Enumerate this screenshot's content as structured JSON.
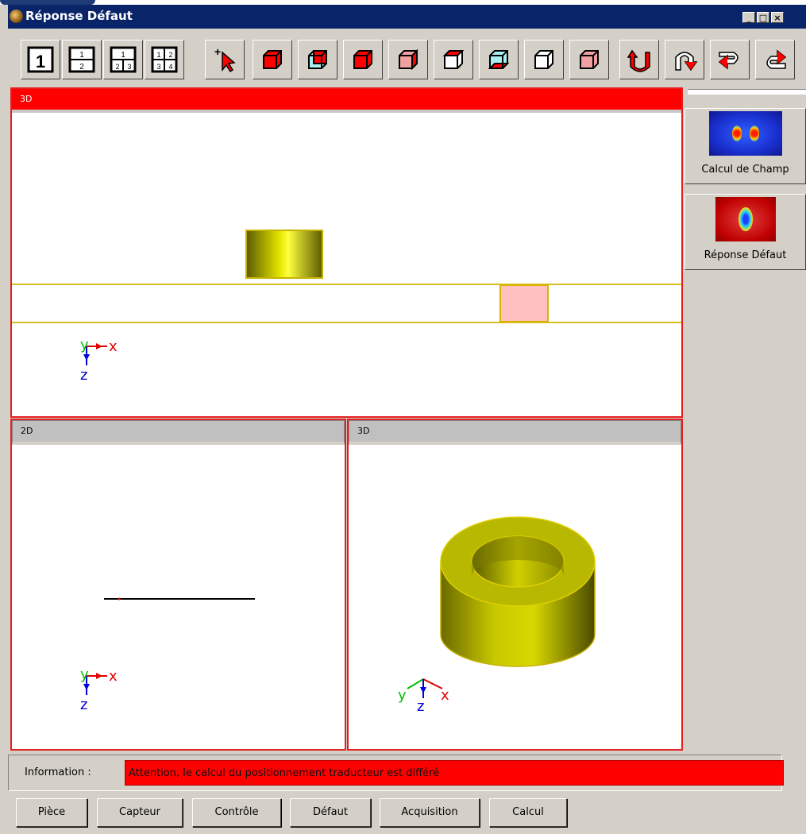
{
  "window": {
    "title": "Réponse Défaut",
    "min_label": "_",
    "max_label": "□",
    "close_label": "×"
  },
  "toolbar": {
    "layout_buttons": [
      {
        "name": "layout-1-button",
        "icon": "layout-single-icon"
      },
      {
        "name": "layout-2-button",
        "icon": "layout-split-2-icon"
      },
      {
        "name": "layout-3-button",
        "icon": "layout-split-3-icon"
      },
      {
        "name": "layout-4-button",
        "icon": "layout-split-4-icon"
      }
    ],
    "tools": [
      "select-add-icon",
      "cube-front-icon",
      "cube-back-icon",
      "cube-left-icon",
      "cube-right-icon",
      "cube-top-icon",
      "cube-bottom-icon",
      "cube-iso-1-icon",
      "cube-iso-2-icon",
      "rotate-up-icon",
      "rotate-down-icon",
      "rotate-left-icon",
      "rotate-right-icon"
    ]
  },
  "panels": {
    "top": {
      "label": "3D"
    },
    "bottom_left": {
      "label": "2D"
    },
    "bottom_right": {
      "label": "3D"
    }
  },
  "axes": {
    "y": "y",
    "x": "x",
    "z": "z"
  },
  "side": {
    "calc_field_label": "Calcul de Champ",
    "defect_response_label": "Réponse Défaut"
  },
  "info": {
    "label": "Information :",
    "value": "Attention, le calcul du positionnement traducteur est différé"
  },
  "bottom_buttons": [
    "Pièce",
    "Capteur",
    "Contrôle",
    "Défaut",
    "Acquisition",
    "Calcul"
  ],
  "colors": {
    "accent_red": "#ff0000",
    "shape_yellow": "#d8d800",
    "highlight_pink": "#ffc0c0"
  }
}
